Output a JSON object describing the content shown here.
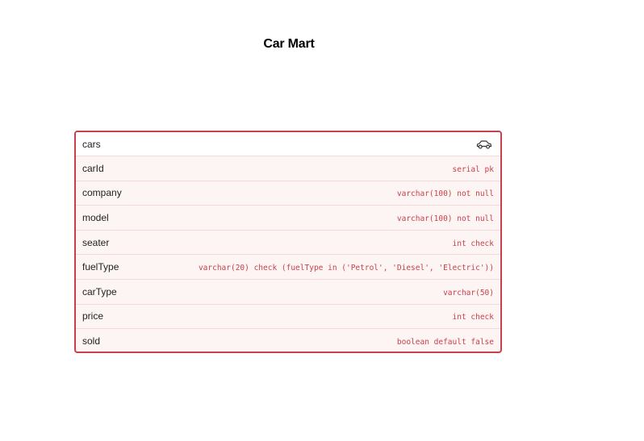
{
  "diagram": {
    "title": "Car Mart"
  },
  "table": {
    "name": "cars",
    "icon": "car-icon",
    "accent_color": "#c9404a",
    "fields": [
      {
        "name": "carId",
        "type": "serial pk"
      },
      {
        "name": "company",
        "type": "varchar(100) not null"
      },
      {
        "name": "model",
        "type": "varchar(100) not null"
      },
      {
        "name": "seater",
        "type": "int check"
      },
      {
        "name": "fuelType",
        "type": "varchar(20) check (fuelType in ('Petrol', 'Diesel', 'Electric'))"
      },
      {
        "name": "carType",
        "type": "varchar(50)"
      },
      {
        "name": "price",
        "type": "int check"
      },
      {
        "name": "sold",
        "type": "boolean default false"
      }
    ]
  }
}
